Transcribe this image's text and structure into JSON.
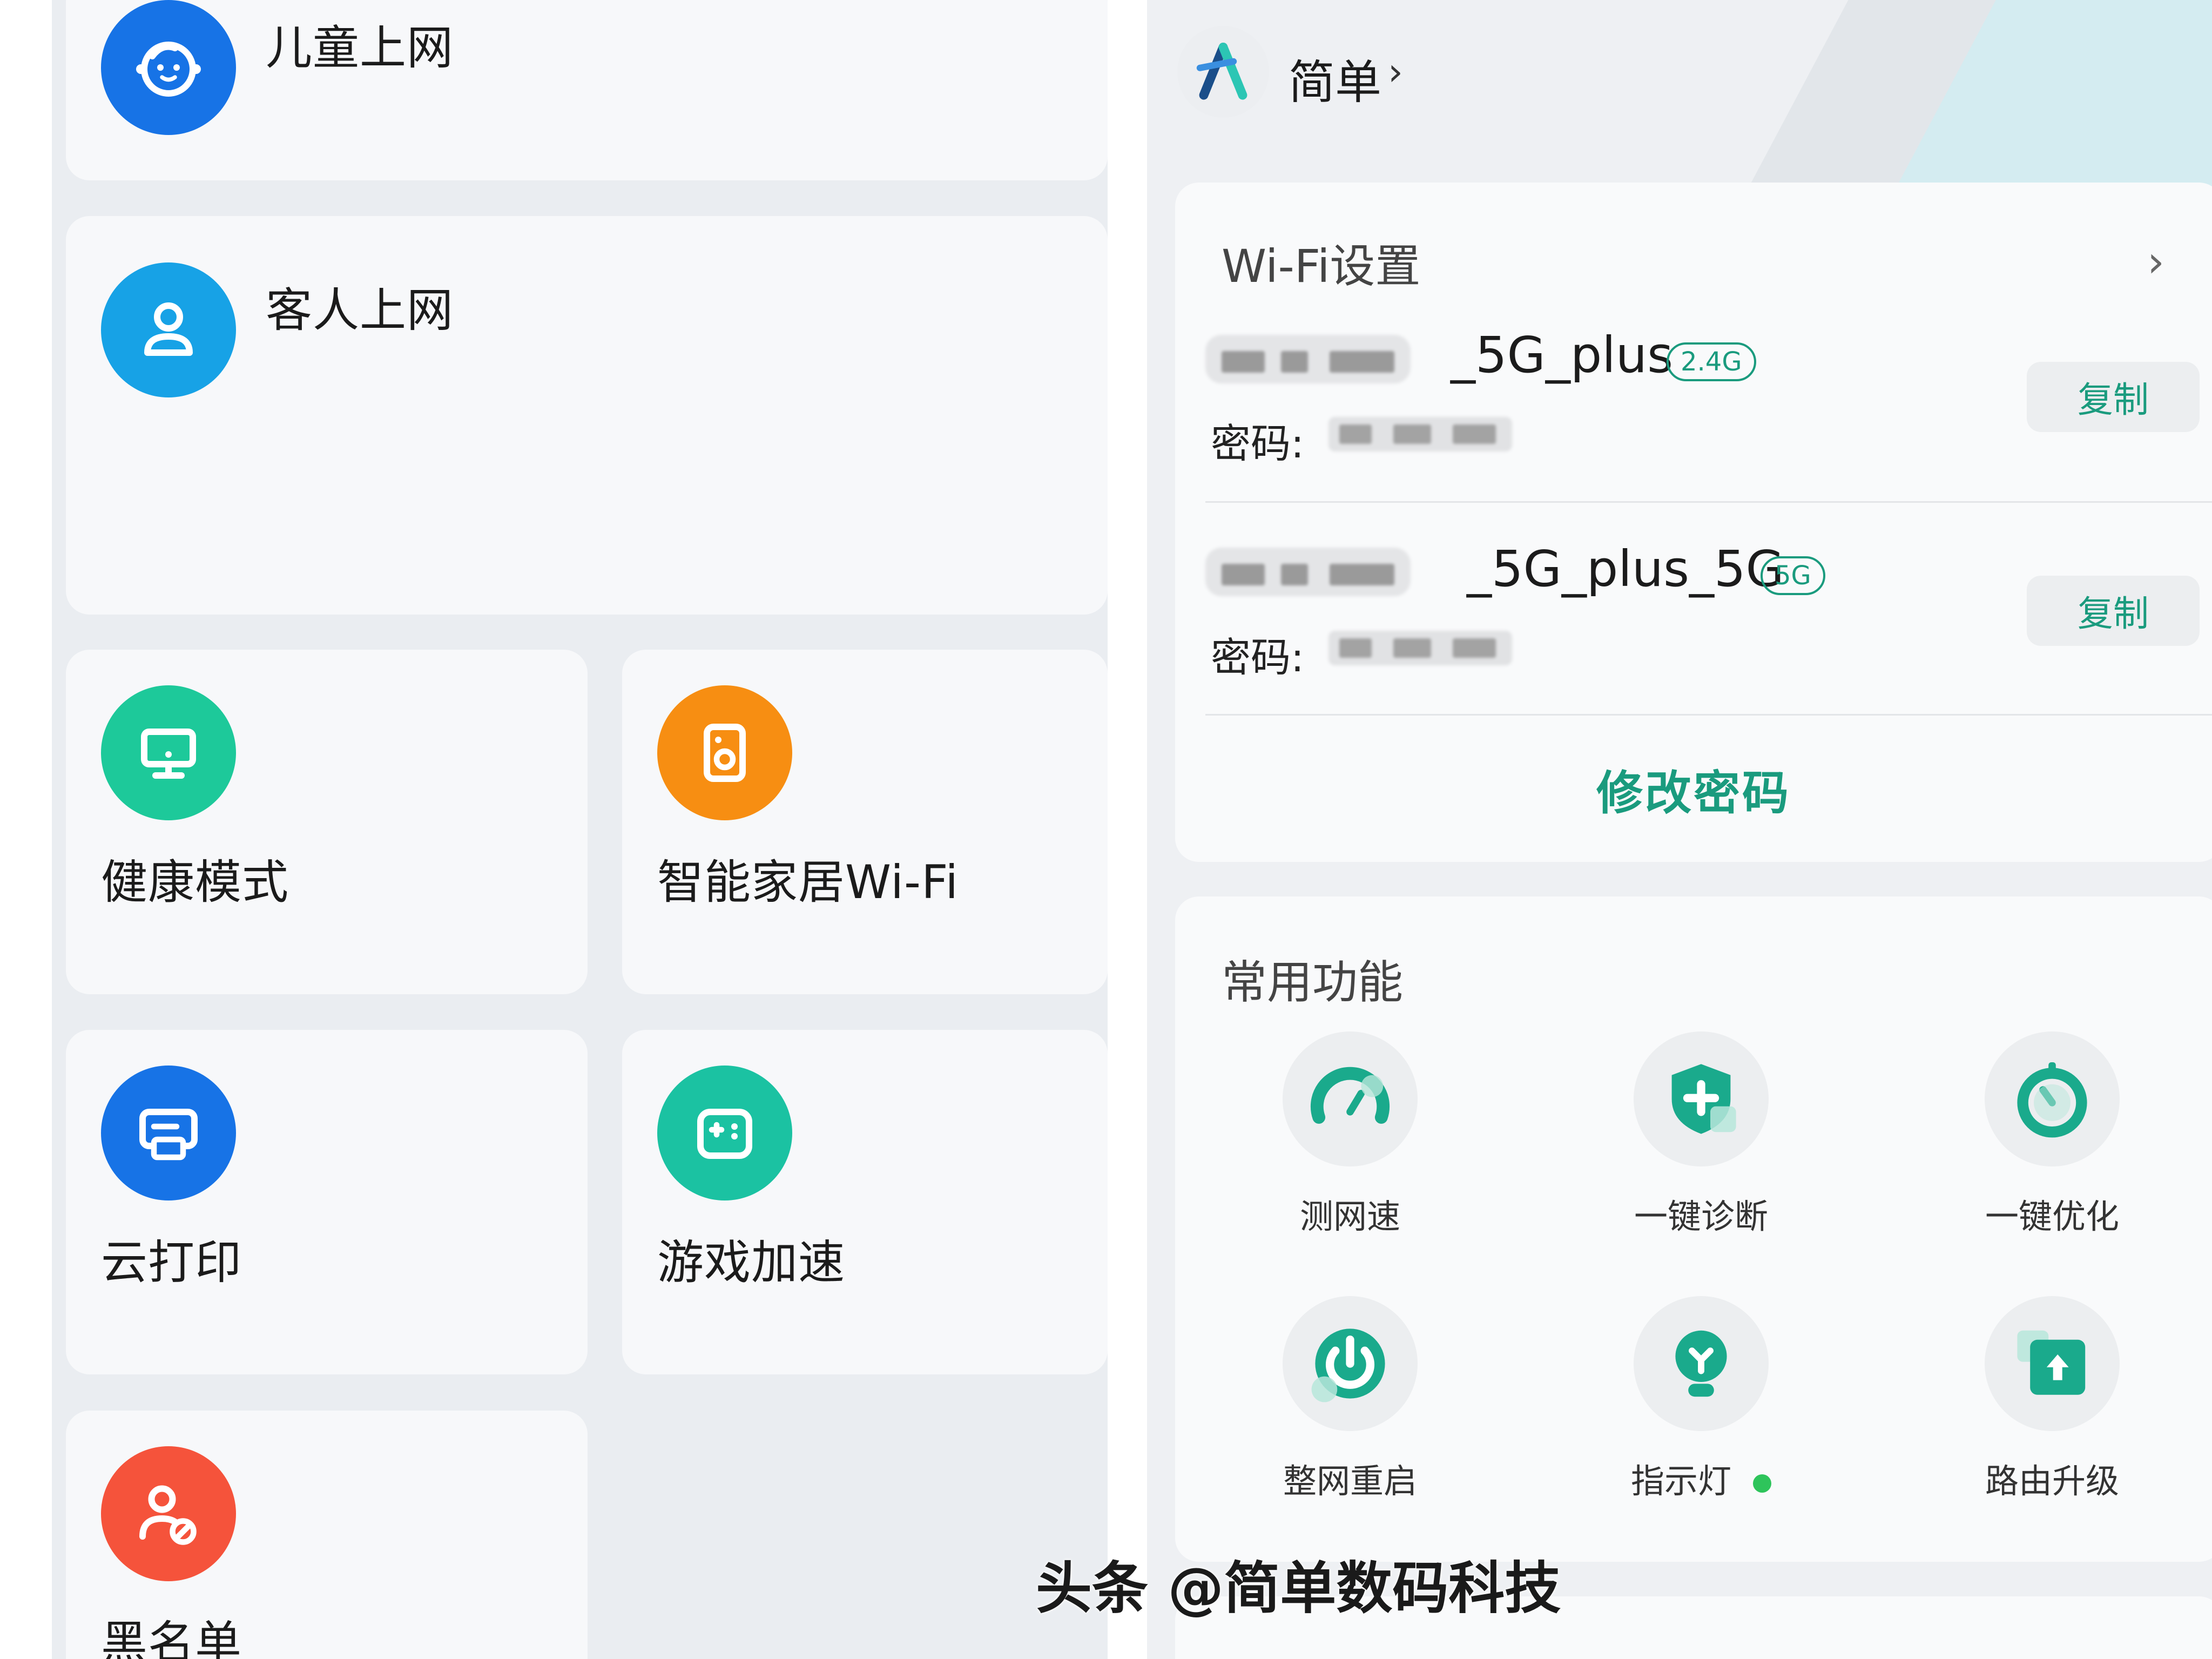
{
  "left": {
    "cards": {
      "kids": {
        "label": "儿童上网",
        "icon": "child-face-icon",
        "color": "#1773e6"
      },
      "guest": {
        "label": "客人上网",
        "icon": "person-icon",
        "color": "#17a2e6"
      },
      "health": {
        "label": "健康模式",
        "icon": "monitor-icon",
        "color": "#1dc99a"
      },
      "smarthome": {
        "label": "智能家居Wi-Fi",
        "icon": "smart-device-icon",
        "color": "#f78e12"
      },
      "cloudprint": {
        "label": "云打印",
        "icon": "printer-icon",
        "color": "#1773e6"
      },
      "game": {
        "label": "游戏加速",
        "icon": "gamepad-icon",
        "color": "#1bc2a2"
      },
      "blacklist": {
        "label": "黑名单",
        "icon": "blocked-user-icon",
        "color": "#f5533b"
      }
    }
  },
  "right": {
    "header": {
      "brand": "简单",
      "chevron": "›",
      "logo_icon": "a-logo-icon"
    },
    "wifi": {
      "title": "Wi-Fi设置",
      "chevron": "›",
      "networks": [
        {
          "ssid_suffix": "_5G_plus",
          "band": "2.4G",
          "password_label": "密码:",
          "copy_label": "复制"
        },
        {
          "ssid_suffix": "_5G_plus_5G",
          "band": "5G",
          "password_label": "密码:",
          "copy_label": "复制"
        }
      ],
      "change_password": "修改密码"
    },
    "common": {
      "title": "常用功能",
      "items": [
        {
          "label": "测网速",
          "icon": "speedometer-icon"
        },
        {
          "label": "一键诊断",
          "icon": "shield-plus-icon"
        },
        {
          "label": "一键优化",
          "icon": "optimize-timer-icon"
        },
        {
          "label": "整网重启",
          "icon": "power-restart-icon"
        },
        {
          "label": "指示灯",
          "icon": "indicator-light-icon"
        },
        {
          "label": "路由升级",
          "icon": "upgrade-arrow-icon"
        }
      ],
      "accent": "#1aaa8c",
      "status_color": "#2ec45b"
    },
    "watermark": "头条 @简单数码科技"
  }
}
